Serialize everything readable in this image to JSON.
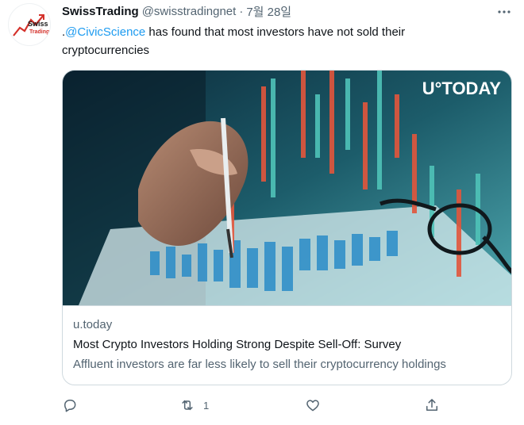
{
  "author": {
    "name": "SwissTrading",
    "handle": "@swisstradingnet",
    "separator": "·",
    "date": "7월 28일",
    "avatar_logo_text": [
      "Swiss",
      "Trading"
    ]
  },
  "tweet": {
    "prefix": ".",
    "mention": "@CivicScience",
    "text_line1_rest": " has found that most investors have not sold their",
    "text_line2": "cryptocurrencies"
  },
  "card": {
    "image_brand": "U°TODAY",
    "domain": "u.today",
    "title": "Most Crypto Investors Holding Strong Despite Sell-Off: Survey",
    "description": "Affluent investors are far less likely to sell their cryptocurrency holdings"
  },
  "actions": {
    "reply_icon": "reply-icon",
    "retweet_icon": "retweet-icon",
    "retweet_count": "1",
    "like_icon": "heart-icon",
    "share_icon": "share-icon"
  },
  "colors": {
    "accent": "#1d9bf0",
    "secondary_text": "#536471",
    "border": "#cfd9de"
  }
}
